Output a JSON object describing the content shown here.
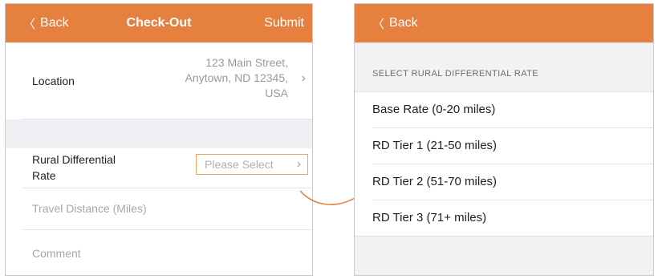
{
  "checkout": {
    "nav": {
      "back_label": "Back",
      "title": "Check-Out",
      "submit_label": "Submit"
    },
    "location": {
      "label": "Location",
      "value_lines": [
        "123 Main Street,",
        "Anytown, ND 12345,",
        "USA"
      ]
    },
    "rural_rate": {
      "label_lines": [
        "Rural Differential",
        "Rate"
      ],
      "placeholder": "Please Select"
    },
    "travel_distance": {
      "label": "Travel Distance (Miles)"
    },
    "comment": {
      "label": "Comment"
    }
  },
  "rate_picker": {
    "nav": {
      "back_label": "Back"
    },
    "section_header": "SELECT RURAL DIFFERENTIAL RATE",
    "options": [
      {
        "label": "Base Rate (0-20 miles)"
      },
      {
        "label": "RD Tier 1 (21-50 miles)"
      },
      {
        "label": "RD Tier 2 (51-70 miles)"
      },
      {
        "label": "RD Tier 3 (71+ miles)"
      }
    ]
  },
  "colors": {
    "accent": "#e6803f",
    "select_border": "#f0a365",
    "muted_text": "#9a9a9a",
    "group_gap": "#efeff4"
  },
  "icons": {
    "back": "chevron-left-icon",
    "disclosure": "chevron-right-icon",
    "flow": "curved-arrow-icon"
  }
}
